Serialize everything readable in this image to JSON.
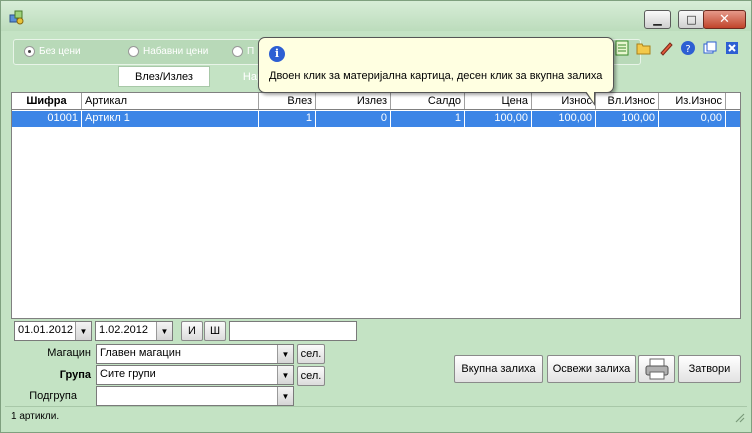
{
  "radios": [
    {
      "label": "Без цени",
      "checked": true
    },
    {
      "label": "Набавни цени",
      "checked": false
    },
    {
      "label": "П",
      "checked": false
    }
  ],
  "tabs": [
    {
      "label": "Влез/Излез",
      "active": true
    },
    {
      "label": "Нар",
      "active": false
    }
  ],
  "tooltip": {
    "text": "Двоен клик за материјална картица, десен клик за вкупна залиха"
  },
  "toolbar_icons": [
    "document-icon",
    "folder-open-icon",
    "pencil-icon",
    "help-icon",
    "window-icon",
    "close-icon"
  ],
  "grid": {
    "columns": [
      "Шифра",
      "Артикал",
      "Влез",
      "Излез",
      "Салдо",
      "Цена",
      "Износ",
      "Вл.Износ",
      "Из.Износ"
    ],
    "rows": [
      [
        "01001",
        "Артикл 1",
        "1",
        "0",
        "1",
        "100,00",
        "100,00",
        "100,00",
        "0,00"
      ]
    ]
  },
  "filters": {
    "date_from": "01.01.2012",
    "date_to": "1.02.2012",
    "and_label": "И",
    "code_label": "Ш",
    "search_value": "",
    "warehouse_label": "Магацин",
    "warehouse_value": "Главен магацин",
    "group_label": "Група",
    "group_value": "Сите групи",
    "subgroup_label": "Подгрупа",
    "subgroup_value": "",
    "select_label": "сел."
  },
  "buttons": {
    "total_stock": "Вкупна залиха",
    "refresh_stock": "Освежи залиха",
    "close": "Затвори"
  },
  "status": {
    "text": "1 артикли."
  },
  "colors": {
    "window_bg": "#c4e3c4",
    "selection": "#3c85e6",
    "tooltip_bg": "#ffffe1"
  }
}
